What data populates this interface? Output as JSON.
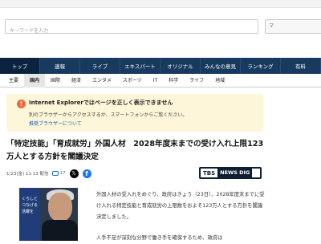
{
  "search": {
    "placeholder": "キーワードを入力",
    "button_label": "マ"
  },
  "nav": {
    "items": [
      {
        "label": "トップ",
        "active": true
      },
      {
        "label": "速報"
      },
      {
        "label": "ライブ"
      },
      {
        "label": "エキスパート"
      },
      {
        "label": "オリジナル"
      },
      {
        "label": "みんなの意見"
      },
      {
        "label": "ランキング"
      },
      {
        "label": "有料"
      }
    ]
  },
  "subnav": {
    "items": [
      {
        "label": "主要"
      },
      {
        "label": "国内",
        "active": true
      },
      {
        "label": "国際"
      },
      {
        "label": "経済"
      },
      {
        "label": "エンタメ"
      },
      {
        "label": "スポーツ"
      },
      {
        "label": "IT"
      },
      {
        "label": "科学"
      },
      {
        "label": "ライフ"
      },
      {
        "label": "地域"
      }
    ]
  },
  "notice": {
    "icon": "!",
    "title": "Internet Explorerではページを正しく表示できません",
    "text": "別のブラウザーからアクセスするか、スマートフォンからご覧ください。",
    "link": "推奨ブラウザーについて"
  },
  "article": {
    "title": "「特定技能」「育成就労」外国人材　2028年度末までの受け入れ上限123万人とする方針を閣議決定",
    "date": "1/23(金) 11:13 配信",
    "comment_count": "17",
    "source_logo": {
      "part1": "TBS",
      "part2": "NEWS DIG"
    },
    "photo_panel_text": "くらしと つなげる 活躍を",
    "paragraphs": [
      "外国人材の受入れをめぐり、政府はきょう（23日）、2028年度末までに受け入れる特定技能と育成就労の上限数をおよそ123万人とする方針を閣議決定しました。",
      "人手不足が深刻な分野で働き手を確保するため、政府は"
    ]
  },
  "colors": {
    "nav_bg": "#183a5e",
    "notice_bg": "#fdf6d8",
    "link": "#1a5fb4"
  }
}
